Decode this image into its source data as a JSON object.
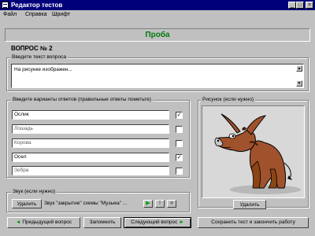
{
  "window": {
    "title": "Редактор тестов",
    "controls": {
      "minimize": "_",
      "maximize": "□",
      "close": "×"
    }
  },
  "menu": {
    "items": [
      "Файл",
      "Справка",
      "Шрифт"
    ]
  },
  "test_title": "Проба",
  "question": {
    "heading": "ВОПРОС № 2",
    "group_label": "Введите текст вопроса",
    "text": "На рисунке изображен..."
  },
  "answers": {
    "group_label": "Введите варианты ответов (правильные ответы пометьте)",
    "items": [
      {
        "text": "Ослик",
        "correct": true
      },
      {
        "text": "Лошадь",
        "correct": false
      },
      {
        "text": "Корова",
        "correct": false
      },
      {
        "text": "Осел",
        "correct": true
      },
      {
        "text": "Зебра",
        "correct": false
      }
    ],
    "check_mark": "✓"
  },
  "picture": {
    "group_label": "Рисунок (если нужно)",
    "delete_label": "Удалить",
    "icon": "donkey-illustration"
  },
  "sound": {
    "group_label": "Звук (если нужно)",
    "delete_label": "Удалить",
    "description": "Звук \"закрытие\" схемы \"Музыка\" ...",
    "play_icon": "▶",
    "pause_icon": "‖",
    "stop_icon": "■",
    "accent_color": "#00a000"
  },
  "footer": {
    "prev_label": "Предыдущий вопрос",
    "remember_label": "Запомнить",
    "next_label": "Следующий вопрос",
    "save_label": "Сохранить тест и закончить работу"
  }
}
